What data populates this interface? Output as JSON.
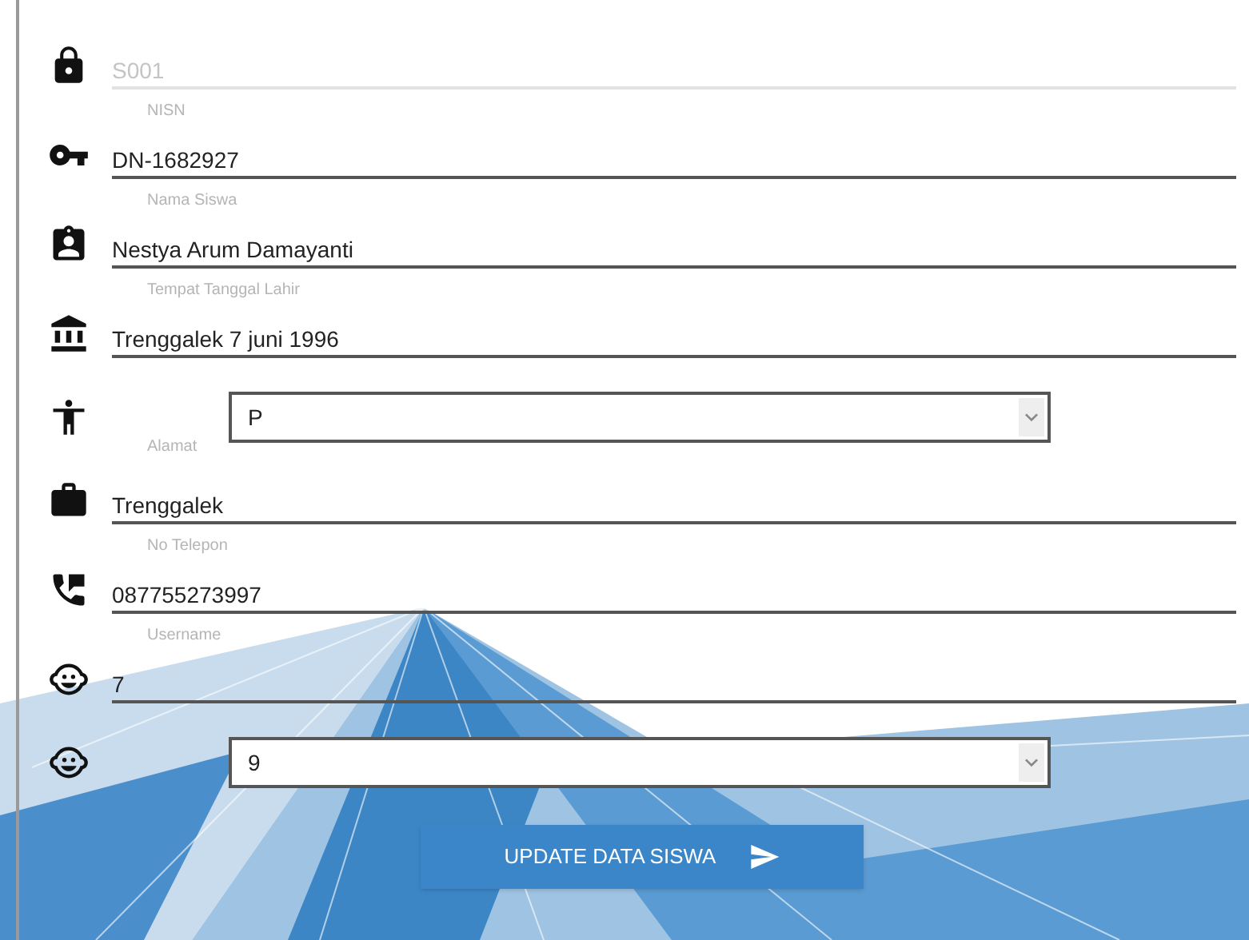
{
  "form": {
    "items": [
      {
        "kind": "input",
        "value": "S001",
        "disabled": true
      },
      {
        "kind": "label",
        "text": "NISN"
      },
      {
        "kind": "input",
        "value": "DN-1682927",
        "disabled": false
      },
      {
        "kind": "label",
        "text": "Nama Siswa"
      },
      {
        "kind": "input",
        "value": "Nestya Arum Damayanti",
        "disabled": false
      },
      {
        "kind": "label",
        "text": "Tempat Tanggal Lahir"
      },
      {
        "kind": "input",
        "value": "Trenggalek 7 juni 1996",
        "disabled": false
      },
      {
        "kind": "select",
        "label": "Alamat",
        "value": "P"
      },
      {
        "kind": "input",
        "value": "Trenggalek",
        "disabled": false
      },
      {
        "kind": "label",
        "text": "No Telepon"
      },
      {
        "kind": "input",
        "value": "087755273997",
        "disabled": false
      },
      {
        "kind": "label",
        "text": "Username"
      },
      {
        "kind": "input",
        "value": "7",
        "disabled": false
      },
      {
        "kind": "select",
        "value": "9"
      }
    ],
    "submit_button": {
      "label": "UPDATE DATA SISWA"
    }
  }
}
